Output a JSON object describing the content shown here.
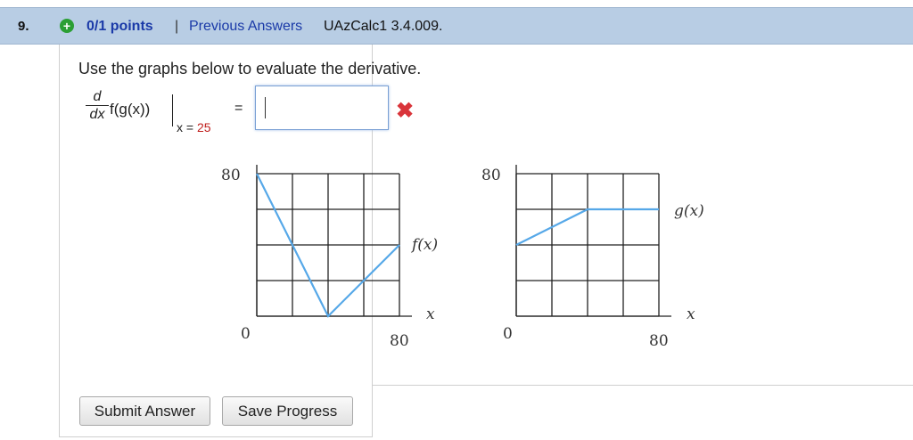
{
  "header": {
    "question_number": "9.",
    "plus_icon": "plus-icon",
    "points": "0/1 points",
    "separator": "|",
    "previous_answers": "Previous Answers",
    "question_id": "UAzCalc1 3.4.009."
  },
  "question": {
    "instruction": "Use the graphs below to evaluate the derivative.",
    "deriv_num": "d",
    "deriv_den": "dx",
    "expression": "f(g(x))",
    "eval_prefix": "x = ",
    "eval_value": "25",
    "equals": "=",
    "answer_value": "",
    "result_icon": "x-mark-icon"
  },
  "chart_data": [
    {
      "type": "line",
      "series": [
        {
          "name": "f(x)",
          "x": [
            0,
            40,
            80
          ],
          "y": [
            80,
            0,
            40
          ]
        }
      ],
      "xlabel": "x",
      "ylabel": "",
      "xlim": [
        0,
        80
      ],
      "ylim": [
        0,
        80
      ],
      "x_ticks": [
        "0",
        "80"
      ],
      "y_ticks": [
        "80"
      ],
      "grid": true,
      "line_color": "#56a8e8"
    },
    {
      "type": "line",
      "series": [
        {
          "name": "g(x)",
          "x": [
            0,
            40,
            80
          ],
          "y": [
            40,
            60,
            60
          ]
        }
      ],
      "xlabel": "x",
      "ylabel": "",
      "xlim": [
        0,
        80
      ],
      "ylim": [
        0,
        80
      ],
      "x_ticks": [
        "0",
        "80"
      ],
      "y_ticks": [
        "80"
      ],
      "grid": true,
      "line_color": "#56a8e8"
    }
  ],
  "buttons": {
    "submit": "Submit Answer",
    "save": "Save Progress"
  }
}
